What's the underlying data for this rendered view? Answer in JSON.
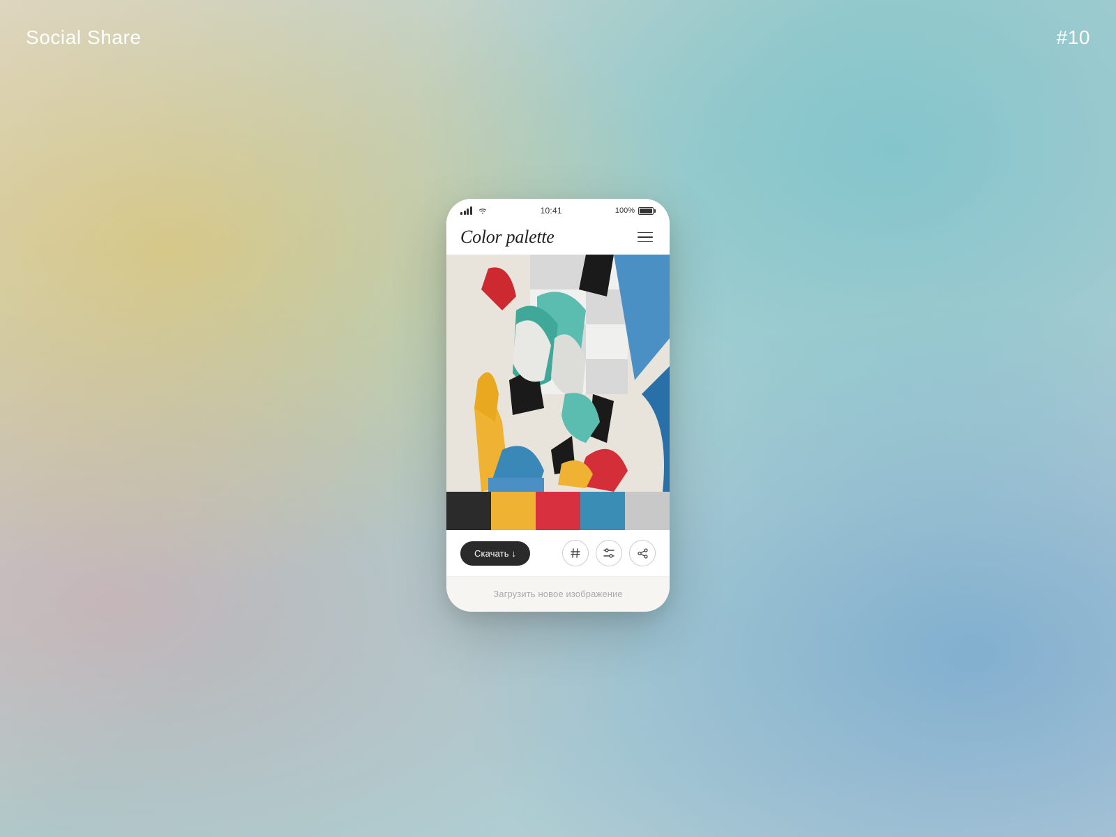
{
  "overlay": {
    "title": "Social Share",
    "number": "#10"
  },
  "status_bar": {
    "time": "10:41",
    "battery_pct": "100%"
  },
  "app_header": {
    "title": "Color palette"
  },
  "palette": {
    "swatches": [
      {
        "color": "#2b2b2b",
        "name": "black"
      },
      {
        "color": "#f0b233",
        "name": "yellow"
      },
      {
        "color": "#d93040",
        "name": "red"
      },
      {
        "color": "#3a8db5",
        "name": "teal-blue"
      },
      {
        "color": "#c8c8c8",
        "name": "light-gray"
      }
    ]
  },
  "actions": {
    "download_label": "Скачать ↓",
    "hash_icon": "#",
    "filter_icon": "⇌",
    "share_icon": "↗"
  },
  "footer": {
    "upload_label": "Загрузить новое изображение"
  }
}
